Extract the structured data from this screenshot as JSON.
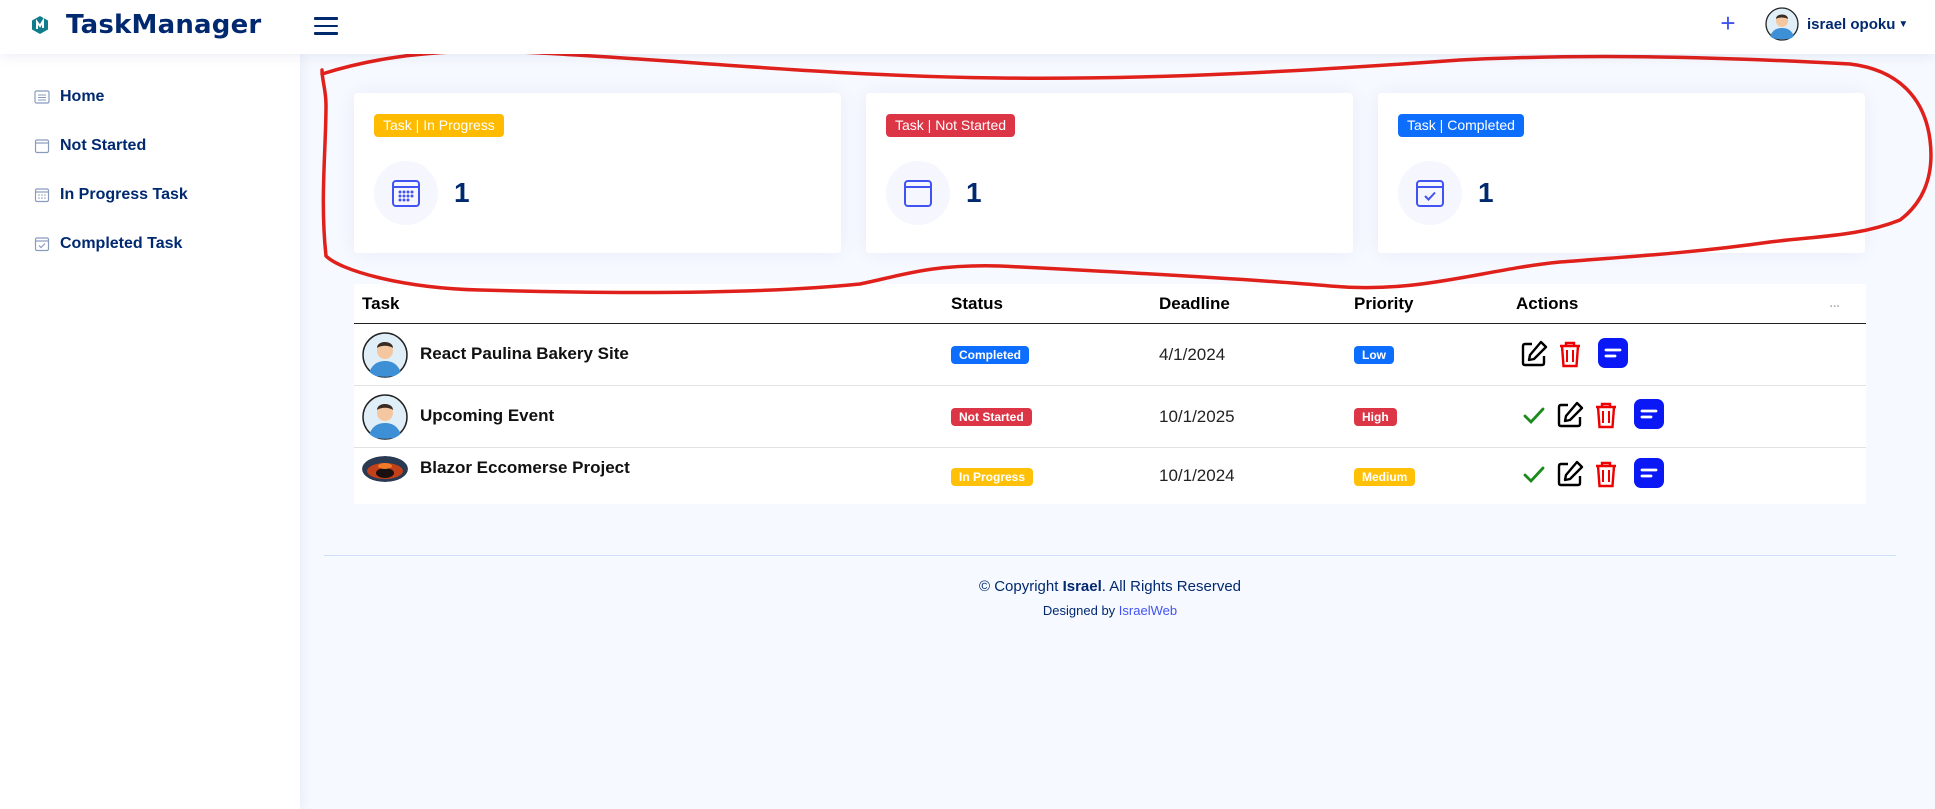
{
  "app": {
    "title": "TaskManager"
  },
  "header": {
    "add_symbol": "+",
    "user_name": "israel opoku"
  },
  "sidebar": {
    "items": [
      {
        "label": "Home",
        "icon": "list-icon"
      },
      {
        "label": "Not Started",
        "icon": "calendar-icon"
      },
      {
        "label": "In Progress Task",
        "icon": "calendar-grid-icon"
      },
      {
        "label": "Completed Task",
        "icon": "calendar-check-icon"
      }
    ]
  },
  "cards": [
    {
      "label": "Task | In Progress",
      "count": "1",
      "color": "#ffbb00",
      "icon": "calendar-grid-icon"
    },
    {
      "label": "Task | Not Started",
      "count": "1",
      "color": "#dc3545",
      "icon": "calendar-icon"
    },
    {
      "label": "Task | Completed",
      "count": "1",
      "color": "#0d6efd",
      "icon": "calendar-check-icon"
    }
  ],
  "table": {
    "headers": [
      "Task",
      "Status",
      "Deadline",
      "Priority",
      "Actions"
    ],
    "more": "...",
    "rows": [
      {
        "task": "React Paulina Bakery Site",
        "status": "Completed",
        "status_color": "#0d6efd",
        "deadline": "4/1/2024",
        "priority": "Low",
        "priority_color": "#0d6efd",
        "actions": [
          "edit",
          "delete",
          "details"
        ]
      },
      {
        "task": "Upcoming Event",
        "status": "Not Started",
        "status_color": "#dc3545",
        "deadline": "10/1/2025",
        "priority": "High",
        "priority_color": "#dc3545",
        "actions": [
          "complete",
          "edit",
          "delete",
          "details"
        ]
      },
      {
        "task": "Blazor Eccomerse Project",
        "status": "In Progress",
        "status_color": "#ffc107",
        "deadline": "10/1/2024",
        "priority": "Medium",
        "priority_color": "#ffc107",
        "actions": [
          "complete",
          "edit",
          "delete",
          "details"
        ]
      }
    ]
  },
  "footer": {
    "copyright_prefix": "© Copyright ",
    "copyright_name": "Israel",
    "copyright_suffix": ". All Rights Reserved",
    "designed_by": "Designed by ",
    "designer": "IsraelWeb"
  },
  "colors": {
    "brand": "#012970",
    "accent": "#4154f1",
    "annotation": "#e0201b"
  }
}
